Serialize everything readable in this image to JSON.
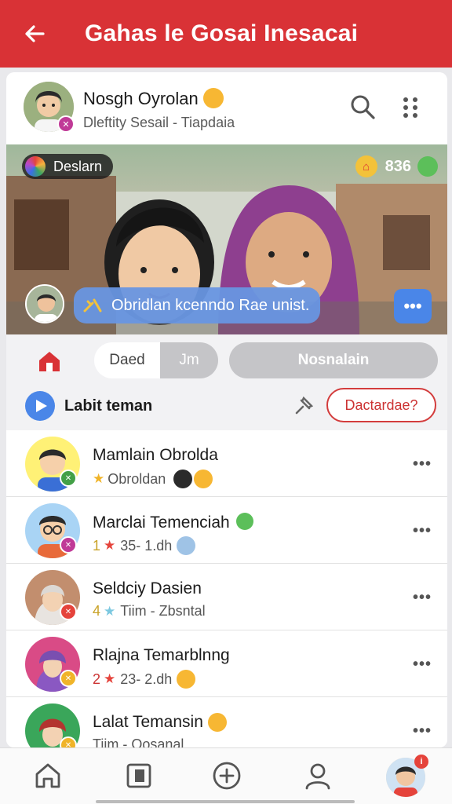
{
  "app_bar": {
    "title": "Gahas le Gosai Inesacai",
    "color": "#d93236"
  },
  "profile": {
    "name": "Nosgh Oyrolan",
    "subtitle": "Dleftity Sesail - Tiapdaia",
    "icons": [
      "search-icon",
      "more-vertical-icon"
    ]
  },
  "hero": {
    "live_label": "Deslarn",
    "coins": "836",
    "bubble_text": "Obridlan kcenndo Rae unist.",
    "bubble_more": "•••"
  },
  "filters": {
    "segments": [
      "Daed",
      "Jm"
    ],
    "pill": "Nosnalain"
  },
  "section": {
    "title": "Labit teman",
    "button": "Dactardae?"
  },
  "list": [
    {
      "name": "Mamlain Obrolda",
      "sub_prefix": "",
      "sub_text": "Obroldan",
      "av_bg": "#fff176",
      "badge_color": "#43a047"
    },
    {
      "name": "Marclai Temenciah",
      "sub_prefix": "1",
      "sub_text": "35- 1.dh",
      "av_bg": "#a9d4f5",
      "badge_color": "#c03a97"
    },
    {
      "name": "Seldciy Dasien",
      "sub_prefix": "4",
      "sub_text": "Tiim - Zbsntal",
      "av_bg": "#c28e6e",
      "badge_color": "#e5433b"
    },
    {
      "name": "Rlajna Temarblnng",
      "sub_prefix": "2",
      "sub_text": "23- 2.dh",
      "av_bg": "#d94b86",
      "badge_color": "#f0b429"
    },
    {
      "name": "Lalat Temansin",
      "sub_prefix": "",
      "sub_text": "Tiim - Oosanal",
      "av_bg": "#3aa65a",
      "badge_color": "#f0b429"
    }
  ],
  "bottom_nav": {
    "items": [
      "home-icon",
      "book-icon",
      "add-icon",
      "profile-icon",
      "avatar"
    ],
    "notification_badge": "i"
  }
}
